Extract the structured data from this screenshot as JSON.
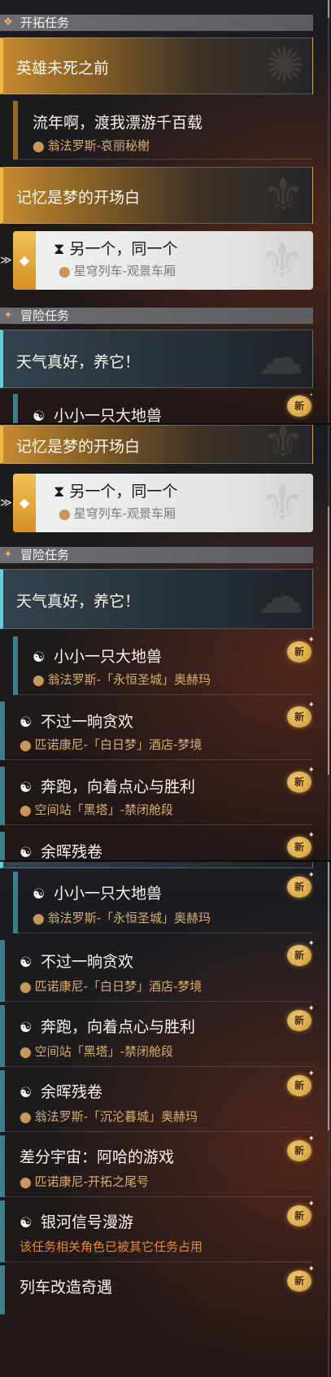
{
  "sections": {
    "trailblaze": "开拓任务",
    "adventure": "冒险任务"
  },
  "quests": {
    "hero": {
      "title": "英雄未死之前"
    },
    "drift": {
      "title": "流年啊，渡我漂游千百载",
      "location": "翁法罗斯-哀丽秘榭"
    },
    "memory": {
      "title": "记忆是梦的开场白"
    },
    "another": {
      "title": "另一个，同一个",
      "location": "星穹列车-观景车厢"
    },
    "weather": {
      "title": "天气真好，养它！"
    },
    "beast": {
      "title": "小小一只大地兽",
      "location": "翁法罗斯-「永恒圣城」奥赫玛"
    },
    "fun": {
      "title": "不过一晌贪欢",
      "location": "匹诺康尼-「白日梦」酒店-梦境"
    },
    "run": {
      "title": "奔跑，向着点心与胜利",
      "location": "空间站「黑塔」-禁闭舱段"
    },
    "remnant": {
      "title": "余晖残卷",
      "location": "翁法罗斯-「沉沦暮城」奥赫玛",
      "location_clipped": "翁法罗斯-「沉沦暮城」奥赫玛"
    },
    "aha": {
      "title": "差分宇宙：阿哈的游戏",
      "location": "匹诺康尼-开拓之尾号"
    },
    "galaxy": {
      "title": "银河信号漫游",
      "status": "该任务相关角色已被其它任务占用"
    },
    "train": {
      "title": "列车改造奇遇"
    }
  },
  "badge": "新",
  "icons": {
    "header": "diamond-star-icon",
    "pin": "location-pin-icon",
    "quest": "companion-quest-icon",
    "hourglass": "hourglass-icon",
    "pointer": "selection-pointer-icon",
    "new": "new-badge-icon"
  },
  "colors": {
    "gold_accent": "#f0b548",
    "teal_accent": "#5fd0db",
    "location": "#d6ae72",
    "warning": "#e7883a"
  }
}
